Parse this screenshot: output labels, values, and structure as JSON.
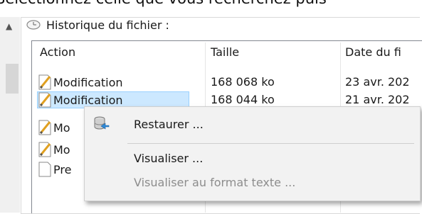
{
  "top_text": "Sélectionnez celle que vous recherchez puis",
  "group": {
    "title": "Historique du fichier :"
  },
  "list": {
    "columns": [
      "Action",
      "Taille",
      "Date du fi"
    ],
    "rows": [
      {
        "action": "Modification",
        "size": "168 068 ko",
        "date": "23 avr. 202"
      },
      {
        "action": "Modification",
        "size": "168 044 ko",
        "date": "21 avr. 202"
      },
      {
        "action": "Mo",
        "size": "",
        "date": ""
      },
      {
        "action": "Mo",
        "size": "",
        "date": ""
      },
      {
        "action": "Pre",
        "size": "",
        "date": ""
      }
    ]
  },
  "context_menu": {
    "items": [
      {
        "label": "Restaurer ...",
        "icon": "restore-database-icon",
        "enabled": true
      },
      {
        "label": "Visualiser ...",
        "enabled": true
      },
      {
        "label": "Visualiser au format texte ...",
        "enabled": false
      }
    ]
  },
  "colors": {
    "selection": "#cce8ff",
    "menu_bg": "#f2f2f2",
    "disabled_text": "#8d8d8d"
  }
}
